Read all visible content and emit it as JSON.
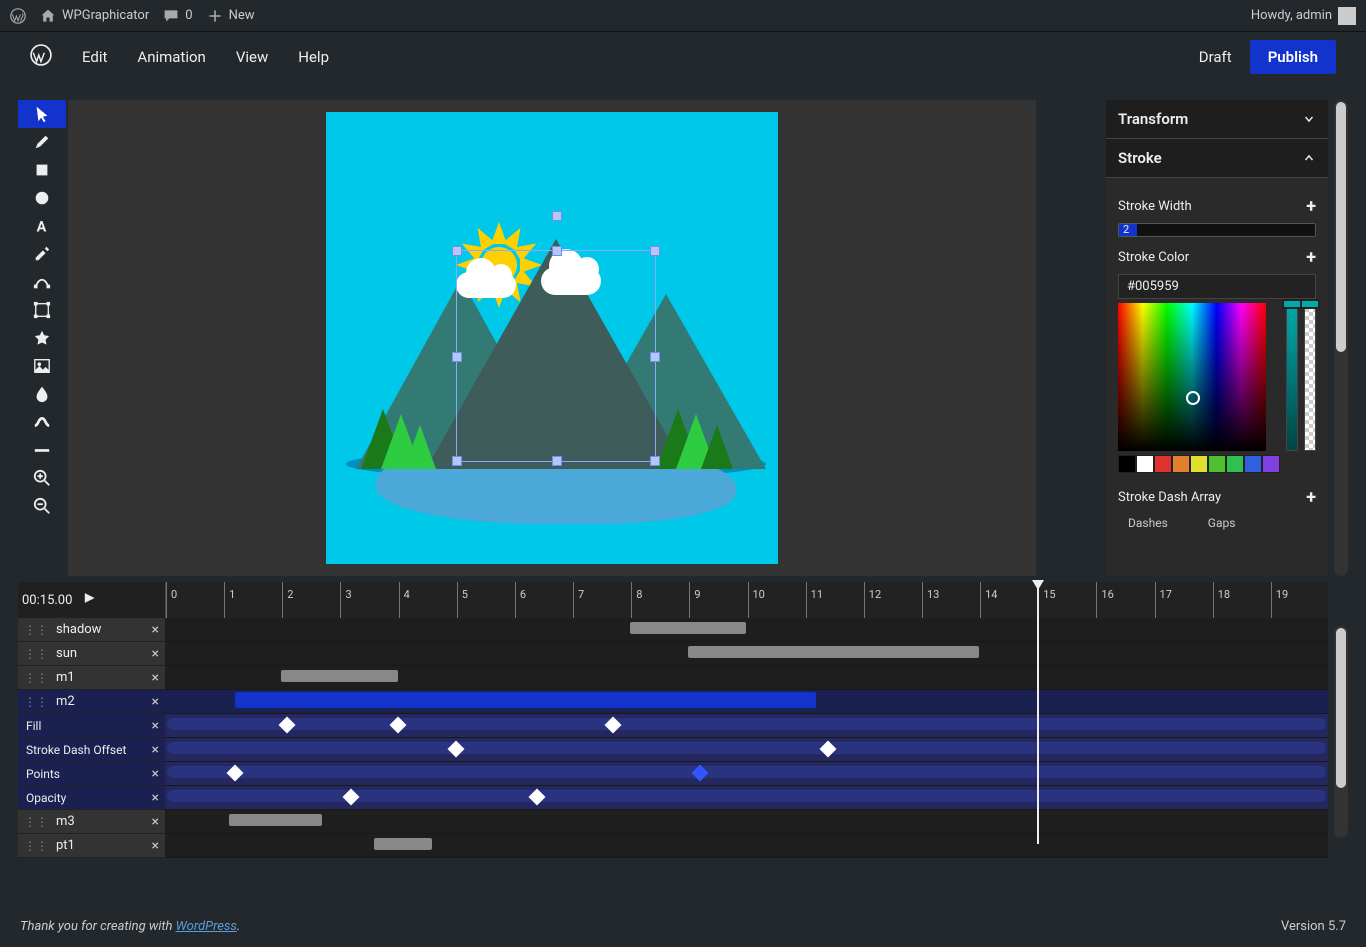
{
  "adminbar": {
    "site": "WPGraphicator",
    "comments": "0",
    "new": "New",
    "howdy": "Howdy, admin"
  },
  "menubar": {
    "edit": "Edit",
    "animation": "Animation",
    "view": "View",
    "help": "Help",
    "draft": "Draft",
    "publish": "Publish"
  },
  "tools": [
    "select-tool",
    "pencil-tool",
    "rect-tool",
    "ellipse-tool",
    "text-tool",
    "eyedropper-tool",
    "path-tool",
    "transform-tool",
    "star-tool",
    "image-tool",
    "blur-tool",
    "stroke-tool",
    "line-tool",
    "zoom-in-tool",
    "zoom-out-tool"
  ],
  "panel": {
    "transform": "Transform",
    "stroke": "Stroke",
    "strokeWidthLabel": "Stroke Width",
    "strokeWidthValue": "2",
    "strokeColorLabel": "Stroke Color",
    "strokeColorValue": "#005959",
    "strokeDashLabel": "Stroke Dash Array",
    "dashes": "Dashes",
    "gaps": "Gaps",
    "swatches": [
      "#000000",
      "#ffffff",
      "#e03030",
      "#e08030",
      "#e0e030",
      "#50c030",
      "#30c050",
      "#3060e0",
      "#8040e0"
    ]
  },
  "timeline": {
    "current": "00:15.00",
    "ticks": [
      "0",
      "1",
      "2",
      "3",
      "4",
      "5",
      "6",
      "7",
      "8",
      "9",
      "10",
      "11",
      "12",
      "13",
      "14",
      "15",
      "16",
      "17",
      "18",
      "19"
    ],
    "playhead_tick": 15,
    "layers": [
      {
        "name": "shadow",
        "bar": {
          "start": 8,
          "end": 10
        }
      },
      {
        "name": "sun",
        "bar": {
          "start": 9,
          "end": 14
        }
      },
      {
        "name": "m1",
        "bar": {
          "start": 2,
          "end": 4
        }
      },
      {
        "name": "m2",
        "selected": true,
        "bar_blue": {
          "start": 1.2,
          "end": 11.2
        },
        "subs": [
          {
            "name": "Fill",
            "keys": [
              2.1,
              4,
              7.7
            ],
            "keys_blue": []
          },
          {
            "name": "Stroke Dash Offset",
            "keys": [
              5,
              11.4
            ],
            "keys_blue": []
          },
          {
            "name": "Points",
            "keys": [
              1.2
            ],
            "keys_blue": [
              9.2
            ]
          },
          {
            "name": "Opacity",
            "keys": [
              3.2,
              6.4
            ],
            "keys_blue": []
          }
        ]
      },
      {
        "name": "m3",
        "bar": {
          "start": 1.1,
          "end": 2.7
        }
      },
      {
        "name": "pt1",
        "bar": {
          "start": 3.6,
          "end": 4.6
        }
      }
    ]
  },
  "footer": {
    "thanks_pre": "Thank you for creating with ",
    "thanks_link": "WordPress",
    "thanks_post": ".",
    "version": "Version 5.7"
  }
}
